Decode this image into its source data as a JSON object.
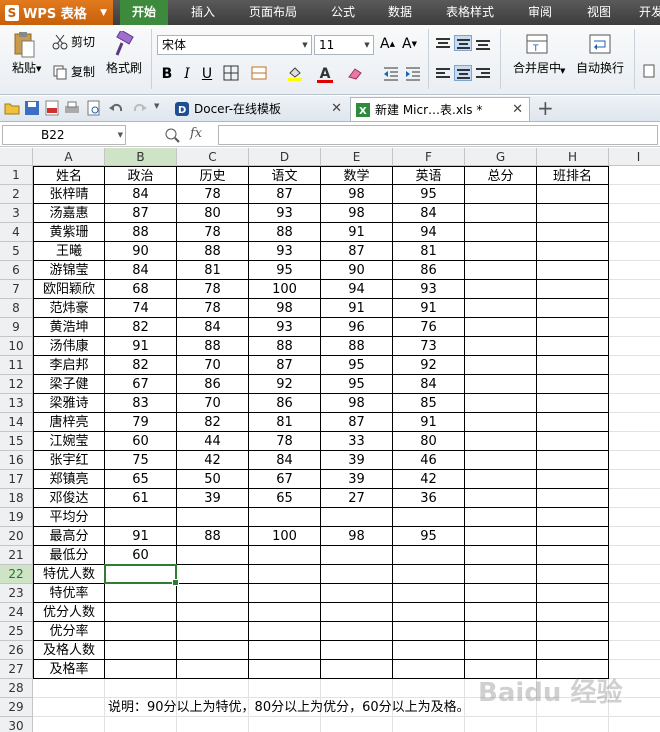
{
  "app": {
    "name": "WPS 表格"
  },
  "menu": [
    "开始",
    "插入",
    "页面布局",
    "公式",
    "数据",
    "表格样式",
    "审阅",
    "视图",
    "开发"
  ],
  "ribbon": {
    "paste": "粘贴",
    "cut": "剪切",
    "copy": "复制",
    "format_painter": "格式刷",
    "font_name": "宋体",
    "font_size": "11",
    "merge_center": "合并居中",
    "wrap_text": "自动换行"
  },
  "tabs": [
    {
      "label": "Docer-在线模板"
    },
    {
      "label": "新建 Micr…表.xls *"
    }
  ],
  "name_box": "B22",
  "fx": "fx",
  "columns": [
    "A",
    "B",
    "C",
    "D",
    "E",
    "F",
    "G",
    "H",
    "I"
  ],
  "headers": [
    "姓名",
    "政治",
    "历史",
    "语文",
    "数学",
    "英语",
    "总分",
    "班排名"
  ],
  "students": [
    [
      "张梓晴",
      "84",
      "78",
      "87",
      "98",
      "95"
    ],
    [
      "汤嘉惠",
      "87",
      "80",
      "93",
      "98",
      "84"
    ],
    [
      "黄紫珊",
      "88",
      "78",
      "88",
      "91",
      "94"
    ],
    [
      "王曦",
      "90",
      "88",
      "93",
      "87",
      "81"
    ],
    [
      "游锦莹",
      "84",
      "81",
      "95",
      "90",
      "86"
    ],
    [
      "欧阳颖欣",
      "68",
      "78",
      "100",
      "94",
      "93"
    ],
    [
      "范炜豪",
      "74",
      "78",
      "98",
      "91",
      "91"
    ],
    [
      "黄浩坤",
      "82",
      "84",
      "93",
      "96",
      "76"
    ],
    [
      "汤伟康",
      "91",
      "88",
      "88",
      "88",
      "73"
    ],
    [
      "李启邦",
      "82",
      "70",
      "87",
      "95",
      "92"
    ],
    [
      "梁子健",
      "67",
      "86",
      "92",
      "95",
      "84"
    ],
    [
      "梁雅诗",
      "83",
      "70",
      "86",
      "98",
      "85"
    ],
    [
      "唐梓亮",
      "79",
      "82",
      "81",
      "87",
      "91"
    ],
    [
      "江婉莹",
      "60",
      "44",
      "78",
      "33",
      "80"
    ],
    [
      "张宇红",
      "75",
      "42",
      "84",
      "39",
      "46"
    ],
    [
      "郑镇亮",
      "65",
      "50",
      "67",
      "39",
      "42"
    ],
    [
      "邓俊达",
      "61",
      "39",
      "65",
      "27",
      "36"
    ]
  ],
  "summary_rows": [
    [
      "平均分",
      "",
      "",
      "",
      "",
      ""
    ],
    [
      "最高分",
      "91",
      "88",
      "100",
      "98",
      "95"
    ],
    [
      "最低分",
      "60",
      "",
      "",
      "",
      ""
    ],
    [
      "特优人数",
      "",
      "",
      "",
      "",
      ""
    ],
    [
      "特优率",
      "",
      "",
      "",
      "",
      ""
    ],
    [
      "优分人数",
      "",
      "",
      "",
      "",
      ""
    ],
    [
      "优分率",
      "",
      "",
      "",
      "",
      ""
    ],
    [
      "及格人数",
      "",
      "",
      "",
      "",
      ""
    ],
    [
      "及格率",
      "",
      "",
      "",
      "",
      ""
    ]
  ],
  "note": "说明：90分以上为特优，80分以上为优分，60分以上为及格。",
  "watermark": "Baidu 经验",
  "row_numbers": [
    "1",
    "2",
    "3",
    "4",
    "5",
    "6",
    "7",
    "8",
    "9",
    "10",
    "11",
    "12",
    "13",
    "14",
    "15",
    "16",
    "17",
    "18",
    "19",
    "20",
    "21",
    "22",
    "23",
    "24",
    "25",
    "26",
    "27",
    "28",
    "29",
    "30"
  ],
  "selected": {
    "col": "B",
    "row": "22"
  },
  "colors": {
    "accent": "#3d8a3d",
    "app": "#d86b14",
    "selection": "#2e7d32"
  }
}
